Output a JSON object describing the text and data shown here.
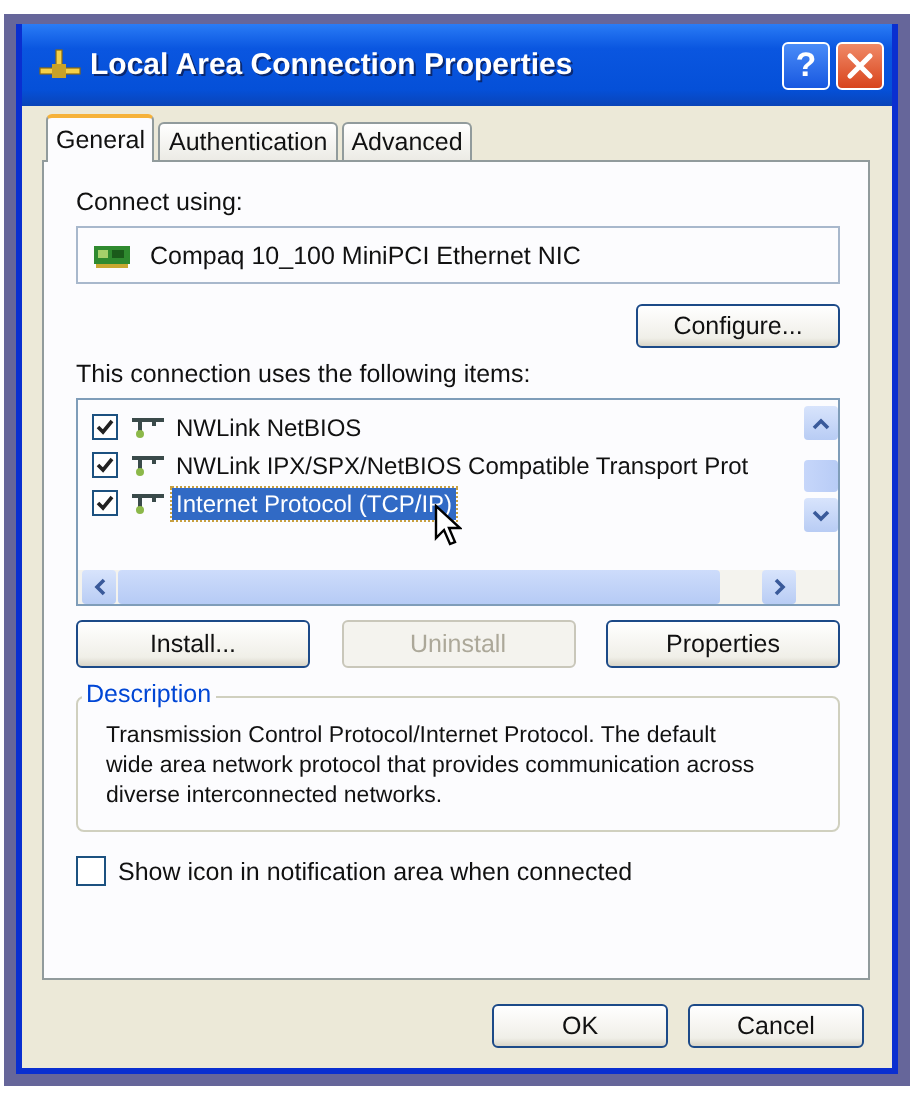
{
  "window": {
    "title": "Local Area Connection Properties",
    "help_button": "?"
  },
  "tabs": [
    {
      "label": "General",
      "selected": true
    },
    {
      "label": "Authentication",
      "selected": false
    },
    {
      "label": "Advanced",
      "selected": false
    }
  ],
  "connect_using": {
    "label": "Connect using:",
    "adapter": "Compaq 10_100 MiniPCI Ethernet NIC",
    "configure_button": "Configure..."
  },
  "items": {
    "label": "This connection uses the following items:",
    "list": [
      {
        "name": "NWLink NetBIOS",
        "checked": true,
        "selected": false
      },
      {
        "name": "NWLink IPX/SPX/NetBIOS Compatible Transport Prot",
        "checked": true,
        "selected": false
      },
      {
        "name": "Internet Protocol (TCP/IP)",
        "checked": true,
        "selected": true
      }
    ]
  },
  "item_buttons": [
    {
      "label": "Install...",
      "disabled": false
    },
    {
      "label": "Uninstall",
      "disabled": true
    },
    {
      "label": "Properties",
      "disabled": false
    }
  ],
  "description": {
    "title": "Description",
    "text": "Transmission Control Protocol/Internet Protocol. The default wide area network protocol that provides communication across diverse interconnected networks."
  },
  "notification_checkbox": {
    "label": "Show icon in notification area when connected",
    "checked": false
  },
  "buttons": [
    "OK",
    "Cancel"
  ]
}
